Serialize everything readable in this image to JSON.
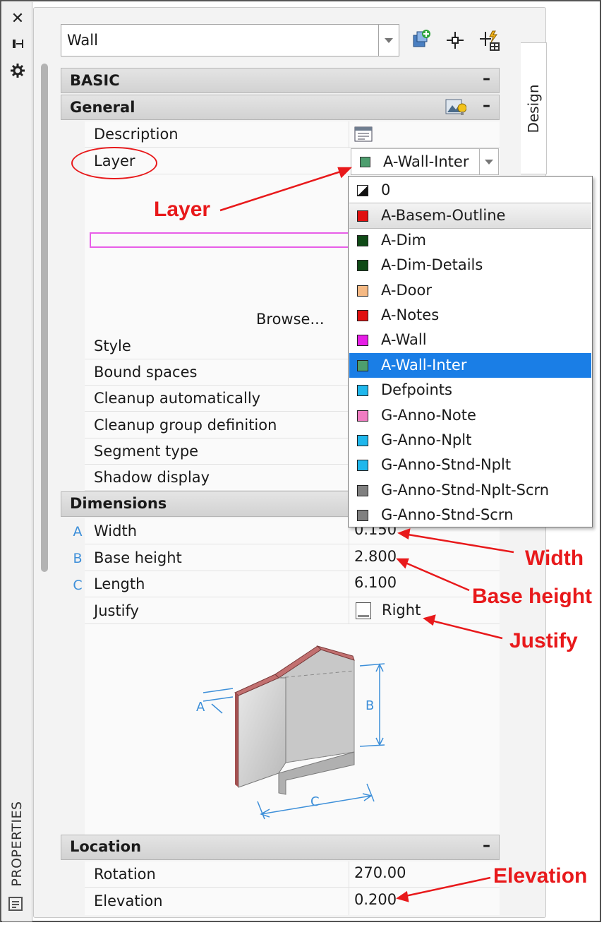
{
  "object_selector": {
    "value": "Wall"
  },
  "side_tab": {
    "label": "Design"
  },
  "left_strip": {
    "panel_label": "PROPERTIES"
  },
  "sections": {
    "basic": "BASIC",
    "general": "General",
    "dimensions": "Dimensions",
    "location": "Location",
    "collapse": "–"
  },
  "general": {
    "description_label": "Description",
    "layer_label": "Layer",
    "layer_value": "A-Wall-Inter",
    "layer_color": "#4d9e6e",
    "browse_label": "Browse...",
    "style_label": "Style",
    "bound_spaces_label": "Bound spaces",
    "cleanup_auto_label": "Cleanup automatically",
    "cleanup_group_label": "Cleanup group definition",
    "segment_type_label": "Segment type",
    "shadow_display_label": "Shadow display"
  },
  "layer_list": [
    {
      "name": "0",
      "color": "special"
    },
    {
      "name": "A-Basem-Outline",
      "color": "#e01010"
    },
    {
      "name": "A-Dim",
      "color": "#0f4a16"
    },
    {
      "name": "A-Dim-Details",
      "color": "#0f4a16"
    },
    {
      "name": "A-Door",
      "color": "#f5b984"
    },
    {
      "name": "A-Notes",
      "color": "#e01010"
    },
    {
      "name": "A-Wall",
      "color": "#e61ee6"
    },
    {
      "name": "A-Wall-Inter",
      "color": "#4d9e6e",
      "selected": true
    },
    {
      "name": "Defpoints",
      "color": "#1fb7ec"
    },
    {
      "name": "G-Anno-Note",
      "color": "#f07cc2"
    },
    {
      "name": "G-Anno-Nplt",
      "color": "#1fb7ec"
    },
    {
      "name": "G-Anno-Stnd-Nplt",
      "color": "#1fb7ec"
    },
    {
      "name": "G-Anno-Stnd-Nplt-Scrn",
      "color": "#808080"
    },
    {
      "name": "G-Anno-Stnd-Scrn",
      "color": "#808080"
    }
  ],
  "dimensions": {
    "width_letter": "A",
    "width_label": "Width",
    "width_value": "0.150",
    "base_height_letter": "B",
    "base_height_label": "Base height",
    "base_height_value": "2.800",
    "length_letter": "C",
    "length_label": "Length",
    "length_value": "6.100",
    "justify_label": "Justify",
    "justify_value": "Right"
  },
  "diagram_letters": {
    "a": "A",
    "b": "B",
    "c": "C"
  },
  "location": {
    "rotation_label": "Rotation",
    "rotation_value": "270.00",
    "elevation_label": "Elevation",
    "elevation_value": "0.200"
  },
  "annotations": {
    "layer": "Layer",
    "width": "Width",
    "base_height": "Base height",
    "justify": "Justify",
    "elevation": "Elevation"
  },
  "colors": {
    "accent_selected": "#1a7ee6",
    "annotation_red": "#e8191b",
    "dimension_blue": "#3d8fd9"
  }
}
